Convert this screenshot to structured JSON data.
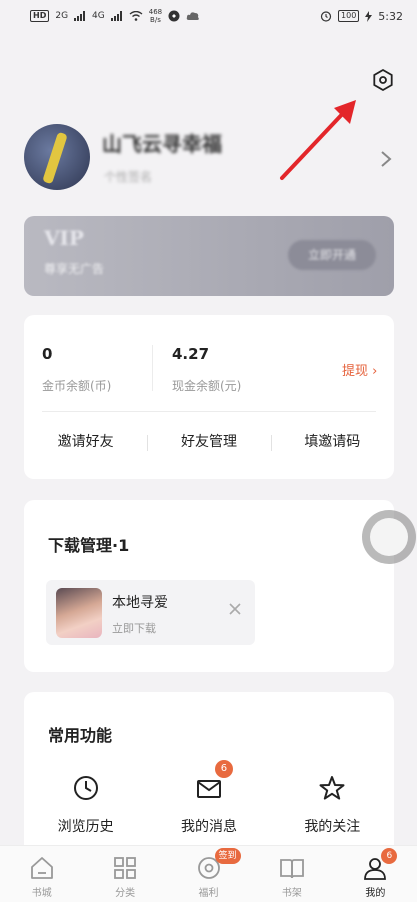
{
  "status_bar": {
    "hd": "HD",
    "signal_1": "2G",
    "signal_2": "4G",
    "net_speed": "468\nB/s",
    "battery": "100",
    "time": "5:32"
  },
  "profile": {
    "username": "山飞云寻幸福",
    "subinfo": "个性签名"
  },
  "vip": {
    "title": "VIP",
    "desc": "尊享无广告",
    "button": "立即开通"
  },
  "wallet": {
    "coin_value": "0",
    "coin_label": "金币余额(币)",
    "cash_value": "4.27",
    "cash_label": "现金余额(元)",
    "withdraw_label": "提现 ›",
    "actions": [
      "邀请好友",
      "好友管理",
      "填邀请码"
    ]
  },
  "downloads": {
    "title": "下载管理·1",
    "item_name": "本地寻爱",
    "item_status": "立即下载"
  },
  "functions": {
    "title": "常用功能",
    "items": [
      {
        "label": "浏览历史",
        "icon": "clock-icon"
      },
      {
        "label": "我的消息",
        "icon": "mail-icon",
        "badge": "6"
      },
      {
        "label": "我的关注",
        "icon": "star-icon"
      }
    ]
  },
  "bottom_nav": {
    "items": [
      {
        "label": "书城",
        "icon": "home-icon"
      },
      {
        "label": "分类",
        "icon": "grid-icon"
      },
      {
        "label": "福利",
        "icon": "coin-icon",
        "badge": "签到"
      },
      {
        "label": "书架",
        "icon": "book-icon"
      },
      {
        "label": "我的",
        "icon": "user-icon",
        "badge": "6"
      }
    ]
  },
  "colors": {
    "accent": "#e86a3f",
    "withdraw": "#e5603a",
    "arrow": "#e3262a"
  }
}
